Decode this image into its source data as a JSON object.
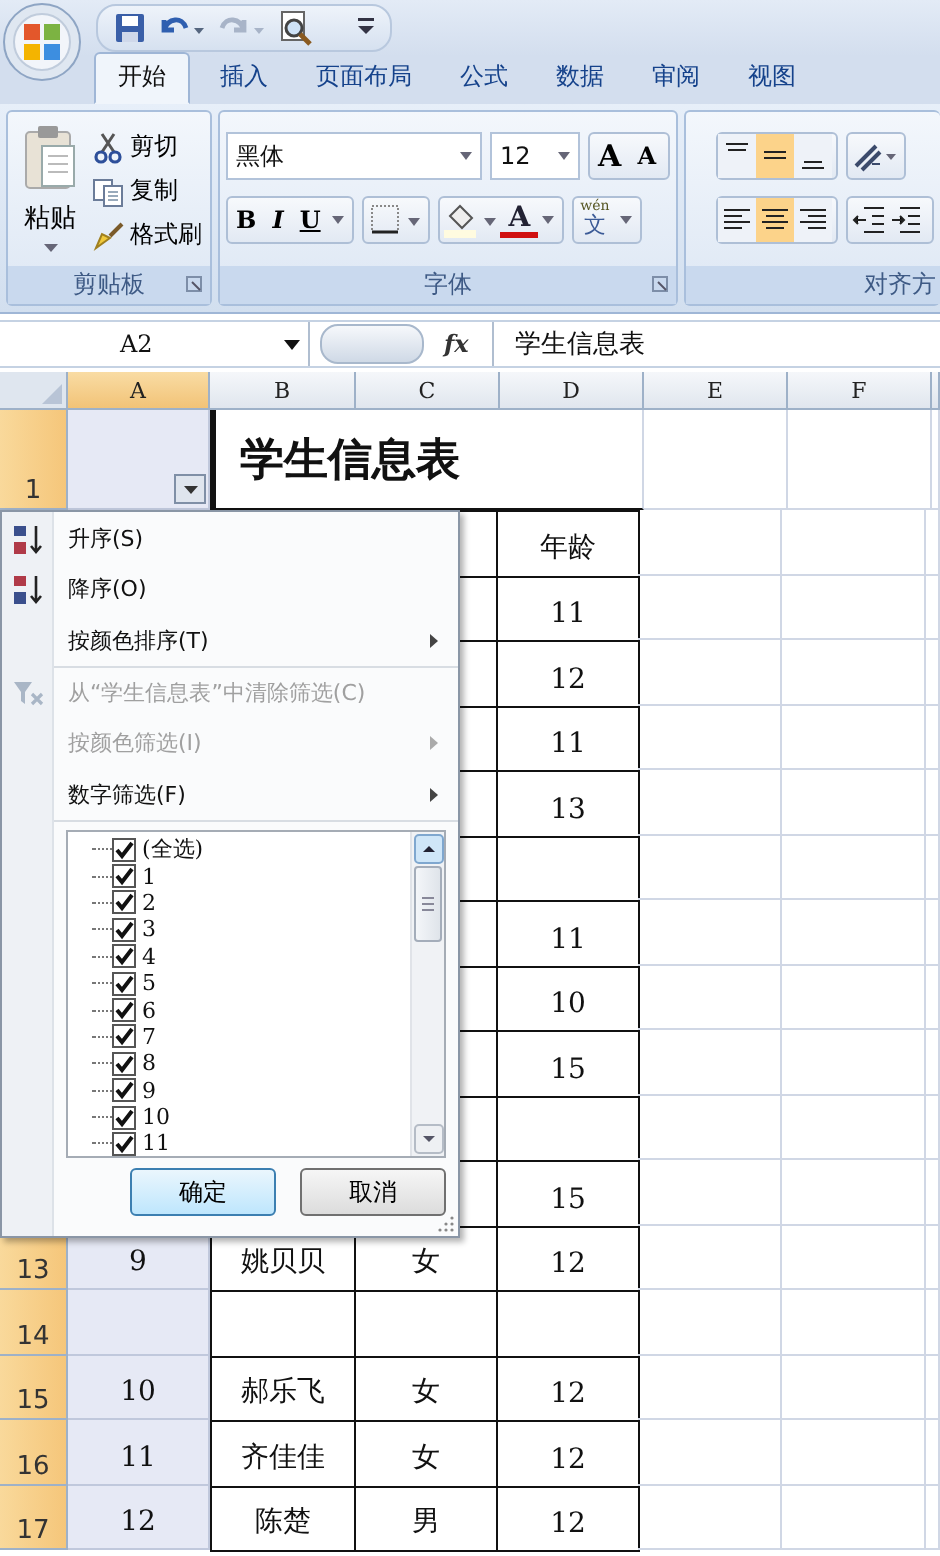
{
  "quick_access": [
    {
      "kind": "save",
      "disabled": false
    },
    {
      "kind": "undo",
      "disabled": false
    },
    {
      "kind": "redo",
      "disabled": true
    },
    {
      "kind": "preview",
      "disabled": false
    }
  ],
  "tabs": [
    {
      "label": "开始",
      "selected": true
    },
    {
      "label": "插入",
      "selected": false
    },
    {
      "label": "页面布局",
      "selected": false
    },
    {
      "label": "公式",
      "selected": false
    },
    {
      "label": "数据",
      "selected": false
    },
    {
      "label": "审阅",
      "selected": false
    },
    {
      "label": "视图",
      "selected": false
    }
  ],
  "clipboard": {
    "label": "剪贴板",
    "paste": "粘贴",
    "actions": [
      {
        "kind": "cut",
        "label": "剪切"
      },
      {
        "kind": "copy",
        "label": "复制"
      },
      {
        "kind": "painter",
        "label": "格式刷"
      }
    ]
  },
  "font": {
    "label": "字体",
    "name": "黑体",
    "size": "12",
    "size_buttons": [
      {
        "kind": "grow",
        "glyph": "A"
      },
      {
        "kind": "shrink",
        "glyph": "A"
      }
    ],
    "styles": [
      {
        "kind": "bold",
        "glyph": "B"
      },
      {
        "kind": "italic",
        "glyph": "I"
      },
      {
        "kind": "underline",
        "glyph": "U"
      }
    ],
    "font_color_glyph": "A",
    "phonetic": {
      "pinyin": "wén",
      "glyph": "文"
    }
  },
  "alignment": {
    "label": "对齐方",
    "vertical": [
      {
        "kind": "top",
        "selected": false
      },
      {
        "kind": "middle",
        "selected": true
      },
      {
        "kind": "bottom",
        "selected": false
      }
    ],
    "horizontal": [
      {
        "kind": "left",
        "selected": false
      },
      {
        "kind": "center",
        "selected": true
      },
      {
        "kind": "right",
        "selected": false
      }
    ]
  },
  "formula_bar": {
    "name_box": "A2",
    "function_glyph": "fx",
    "content": "学生信息表"
  },
  "sheet": {
    "columns": [
      {
        "label": "A",
        "selected": true
      },
      {
        "label": "B",
        "selected": false
      },
      {
        "label": "C",
        "selected": false
      },
      {
        "label": "D",
        "selected": false
      },
      {
        "label": "E",
        "selected": false
      },
      {
        "label": "F",
        "selected": false
      }
    ],
    "rows": [
      {
        "header": "1",
        "selected": true,
        "title": "学生信息表"
      },
      {
        "d": "年龄"
      },
      {
        "d": "11"
      },
      {
        "d": "12"
      },
      {
        "d": "11"
      },
      {
        "d": "13"
      },
      {},
      {
        "d": "11"
      },
      {
        "d": "10"
      },
      {
        "d": "15"
      },
      {},
      {
        "d": "15"
      },
      {
        "header": "13",
        "selected": true,
        "a": "9",
        "b": "姚贝贝",
        "c": "女",
        "d": "12"
      },
      {
        "header": "14",
        "selected": true
      },
      {
        "header": "15",
        "selected": true,
        "a": "10",
        "b": "郝乐飞",
        "c": "女",
        "d": "12"
      },
      {
        "header": "16",
        "selected": true,
        "a": "11",
        "b": "齐佳佳",
        "c": "女",
        "d": "12"
      },
      {
        "header": "17",
        "selected": true,
        "a": "12",
        "b": "陈楚",
        "c": "男",
        "d": "12"
      }
    ]
  },
  "filter_menu": {
    "items": [
      {
        "label": "升序(S)",
        "kind": "sort_ascending",
        "disabled": false,
        "submenu": false,
        "separator_after": false
      },
      {
        "label": "降序(O)",
        "kind": "sort_descending",
        "disabled": false,
        "submenu": false,
        "separator_after": false
      },
      {
        "label": "按颜色排序(T)",
        "kind": "command",
        "disabled": false,
        "submenu": true,
        "separator_after": true
      },
      {
        "label": "从“学生信息表”中清除筛选(C)",
        "kind": "clear_filter",
        "disabled": true,
        "submenu": false,
        "separator_after": false
      },
      {
        "label": "按颜色筛选(I)",
        "kind": "command",
        "disabled": true,
        "submenu": true,
        "separator_after": false
      },
      {
        "label": "数字筛选(F)",
        "kind": "command",
        "disabled": false,
        "submenu": true,
        "separator_after": true
      }
    ],
    "values": [
      {
        "label": "(全选)",
        "checked": true
      },
      {
        "label": "1",
        "checked": true
      },
      {
        "label": "2",
        "checked": true
      },
      {
        "label": "3",
        "checked": true
      },
      {
        "label": "4",
        "checked": true
      },
      {
        "label": "5",
        "checked": true
      },
      {
        "label": "6",
        "checked": true
      },
      {
        "label": "7",
        "checked": true
      },
      {
        "label": "8",
        "checked": true
      },
      {
        "label": "9",
        "checked": true
      },
      {
        "label": "10",
        "checked": true
      },
      {
        "label": "11",
        "checked": true
      }
    ],
    "buttons": [
      {
        "label": "确定",
        "kind": "default"
      },
      {
        "label": "取消",
        "kind": "normal"
      }
    ]
  }
}
